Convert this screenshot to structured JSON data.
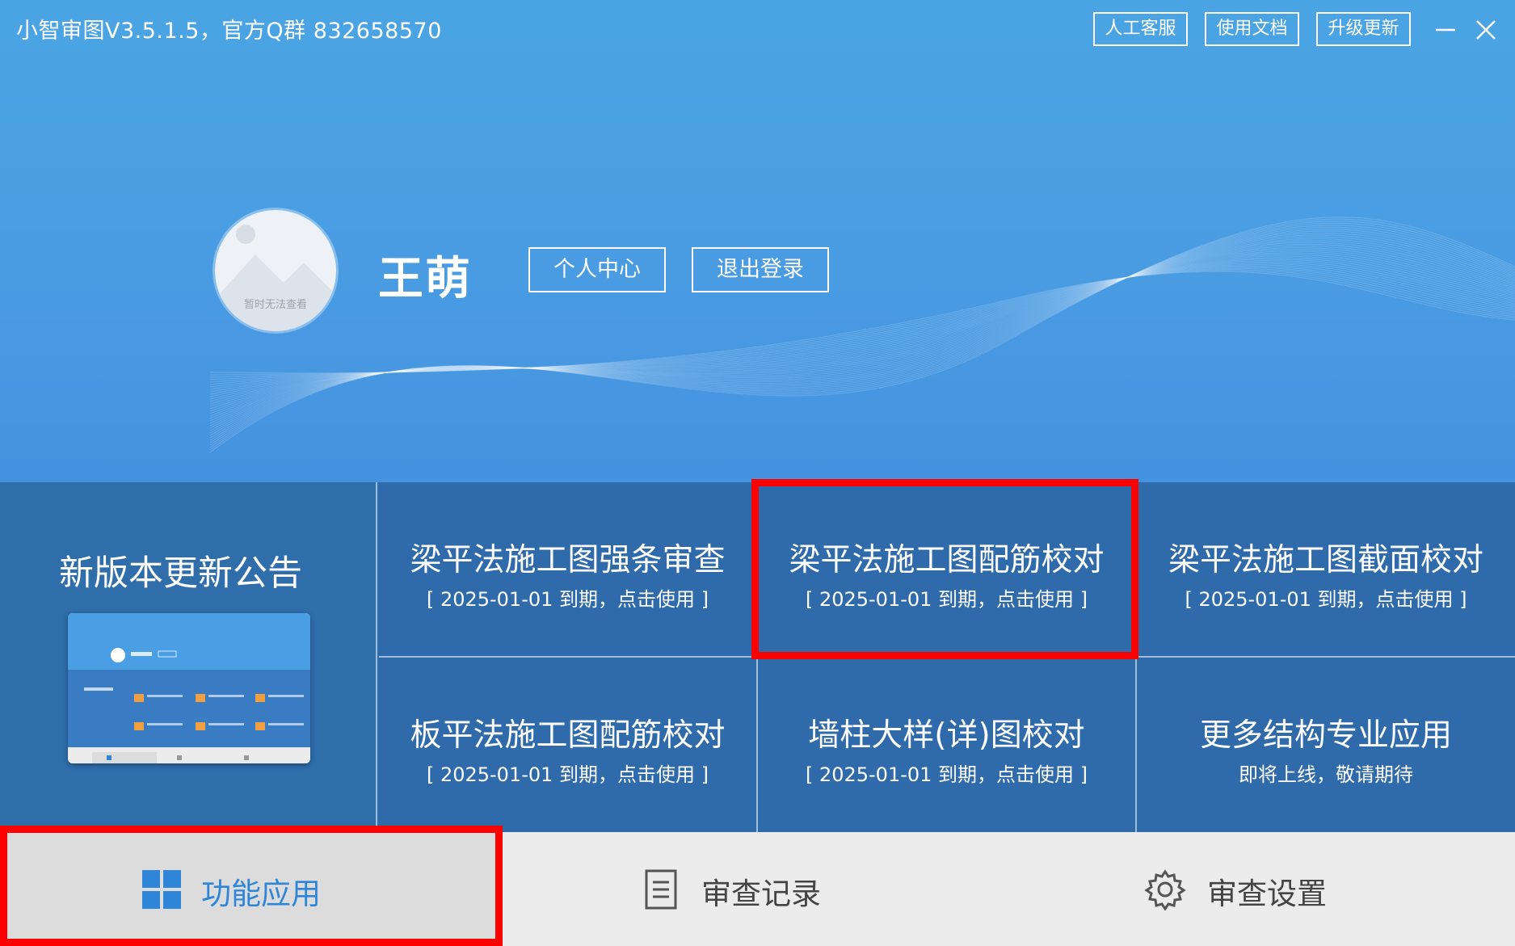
{
  "window": {
    "title": "小智审图V3.5.1.5，官方Q群 832658570",
    "buttons": [
      {
        "label": "人工客服"
      },
      {
        "label": "使用文档"
      },
      {
        "label": "升级更新"
      }
    ],
    "controls": [
      "minimize-icon",
      "close-icon"
    ]
  },
  "user": {
    "name": "王萌",
    "avatar_caption": "暂时无法查看",
    "personal_center": "个人中心",
    "logout": "退出登录"
  },
  "announcement": {
    "title": "新版本更新公告",
    "thumbnail_icon": "app-preview-thumbnail"
  },
  "tiles": [
    {
      "title": "梁平法施工图强条审查",
      "subtitle": "[  2025-01-01  到期，点击使用 ]"
    },
    {
      "title": "梁平法施工图配筋校对",
      "subtitle": "[  2025-01-01  到期，点击使用 ]",
      "highlighted": true
    },
    {
      "title": "梁平法施工图截面校对",
      "subtitle": "[  2025-01-01  到期，点击使用 ]"
    },
    {
      "title": "板平法施工图配筋校对",
      "subtitle": "[  2025-01-01  到期，点击使用 ]"
    },
    {
      "title": "墙柱大样(详)图校对",
      "subtitle": "[  2025-01-01  到期，点击使用 ]"
    },
    {
      "title": "更多结构专业应用",
      "subtitle": "即将上线，敬请期待"
    }
  ],
  "nav": {
    "items": [
      {
        "label": "功能应用",
        "icon": "grid-icon",
        "active": true
      },
      {
        "label": "审查记录",
        "icon": "document-icon",
        "active": false
      },
      {
        "label": "审查设置",
        "icon": "gear-icon",
        "active": false
      }
    ]
  },
  "colors": {
    "header_blue": "#4a9ee3",
    "tile_blue": "#2f6aab",
    "highlight_red": "#ff0000",
    "active_nav_text": "#2f86d8"
  }
}
